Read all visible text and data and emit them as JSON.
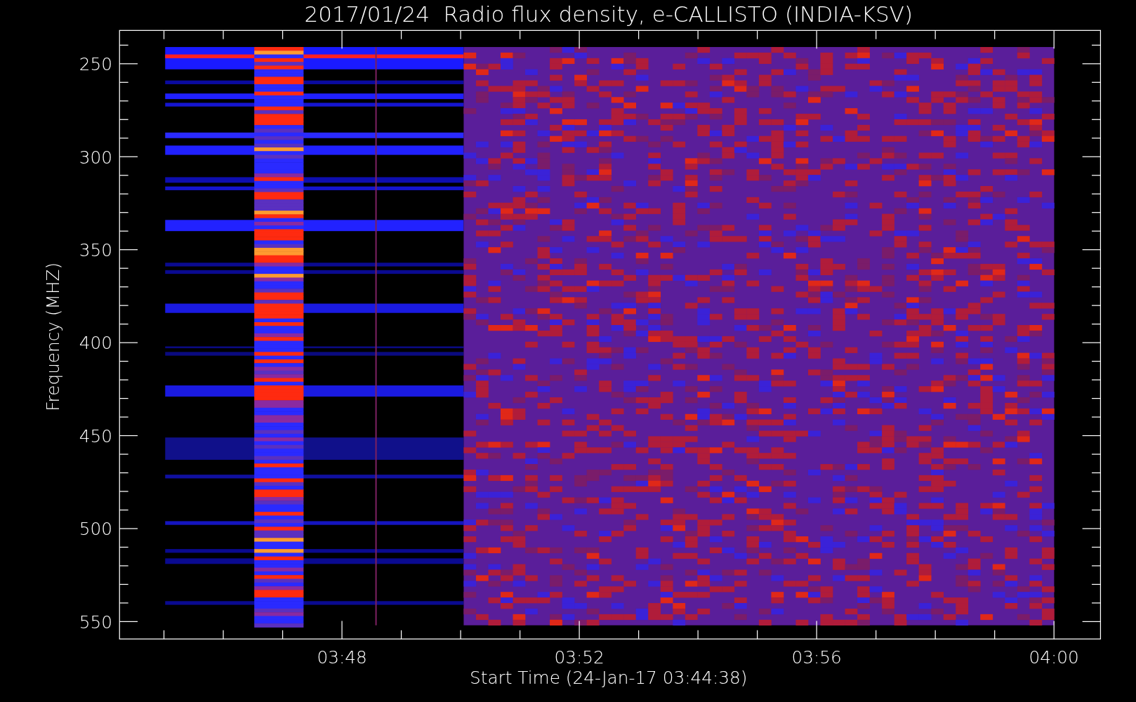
{
  "chart": {
    "title": "2017/01/24  Radio flux density, e-CALLISTO (INDIA-KSV)",
    "ylabel": "Frequency (MHZ)",
    "xlabel": "Start Time (24-Jan-17 03:44:38)",
    "yticks": [
      "250",
      "300",
      "350",
      "400",
      "450",
      "500",
      "550"
    ],
    "xticks": [
      "03:48",
      "03:52",
      "03:56",
      "04:00"
    ]
  }
}
